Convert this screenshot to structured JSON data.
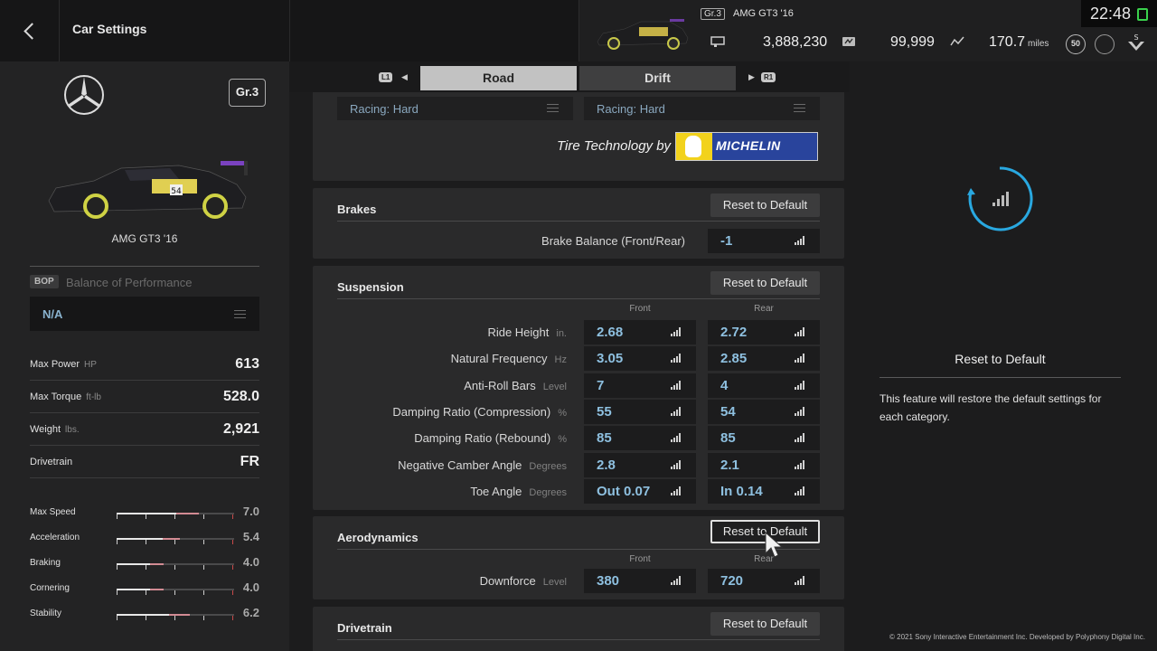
{
  "header": {
    "title": "Car Settings",
    "car_class": "Gr.3",
    "car_name": "AMG GT3 '16",
    "credits": "3,888,230",
    "mileage_points": "99,999",
    "distance": "170.7",
    "distance_unit": "miles",
    "level": "50",
    "time": "22:48"
  },
  "left": {
    "class_badge": "Gr.3",
    "car_name": "AMG GT3 '16",
    "bop_tag": "BOP",
    "bop_label": "Balance of Performance",
    "bop_value": "N/A",
    "specs": [
      {
        "label": "Max Power",
        "unit": "HP",
        "value": "613"
      },
      {
        "label": "Max Torque",
        "unit": "ft-lb",
        "value": "528.0"
      },
      {
        "label": "Weight",
        "unit": "lbs.",
        "value": "2,921"
      },
      {
        "label": "Drivetrain",
        "unit": "",
        "value": "FR"
      }
    ],
    "performance": [
      {
        "label": "Max Speed",
        "value": "7.0",
        "level": 0.7
      },
      {
        "label": "Acceleration",
        "value": "5.4",
        "level": 0.54
      },
      {
        "label": "Braking",
        "value": "4.0",
        "level": 0.4
      },
      {
        "label": "Cornering",
        "value": "4.0",
        "level": 0.4
      },
      {
        "label": "Stability",
        "value": "6.2",
        "level": 0.62
      }
    ]
  },
  "tabs": {
    "left_button": "L1",
    "right_button": "R1",
    "road": "Road",
    "drift": "Drift"
  },
  "tires": {
    "front": "Racing: Hard",
    "rear": "Racing: Hard",
    "tech_by": "Tire Technology by",
    "brand": "MICHELIN"
  },
  "brakes": {
    "title": "Brakes",
    "reset": "Reset to Default",
    "balance_label": "Brake Balance (Front/Rear)",
    "balance_value": "-1"
  },
  "suspension": {
    "title": "Suspension",
    "reset": "Reset to Default",
    "front_header": "Front",
    "rear_header": "Rear",
    "rows": [
      {
        "label": "Ride Height",
        "unit": "in.",
        "front": "2.68",
        "rear": "2.72"
      },
      {
        "label": "Natural Frequency",
        "unit": "Hz",
        "front": "3.05",
        "rear": "2.85"
      },
      {
        "label": "Anti-Roll Bars",
        "unit": "Level",
        "front": "7",
        "rear": "4"
      },
      {
        "label": "Damping Ratio (Compression)",
        "unit": "%",
        "front": "55",
        "rear": "54"
      },
      {
        "label": "Damping Ratio (Rebound)",
        "unit": "%",
        "front": "85",
        "rear": "85"
      },
      {
        "label": "Negative Camber Angle",
        "unit": "Degrees",
        "front": "2.8",
        "rear": "2.1"
      },
      {
        "label": "Toe Angle",
        "unit": "Degrees",
        "front": "Out 0.07",
        "rear": "In 0.14"
      }
    ]
  },
  "aerodynamics": {
    "title": "Aerodynamics",
    "reset": "Reset to Default",
    "front_header": "Front",
    "rear_header": "Rear",
    "downforce_label": "Downforce",
    "downforce_unit": "Level",
    "front": "380",
    "rear": "720"
  },
  "drivetrain": {
    "title": "Drivetrain",
    "reset": "Reset to Default"
  },
  "help": {
    "title": "Reset to Default",
    "text": "This feature will restore the default settings for each category."
  },
  "footer": {
    "copyright": "© 2021 Sony Interactive Entertainment Inc. Developed by Polyphony Digital Inc."
  },
  "colors": {
    "accent_value": "#8ec0e0",
    "loader": "#29a8e0",
    "battery": "#3ad04c"
  }
}
